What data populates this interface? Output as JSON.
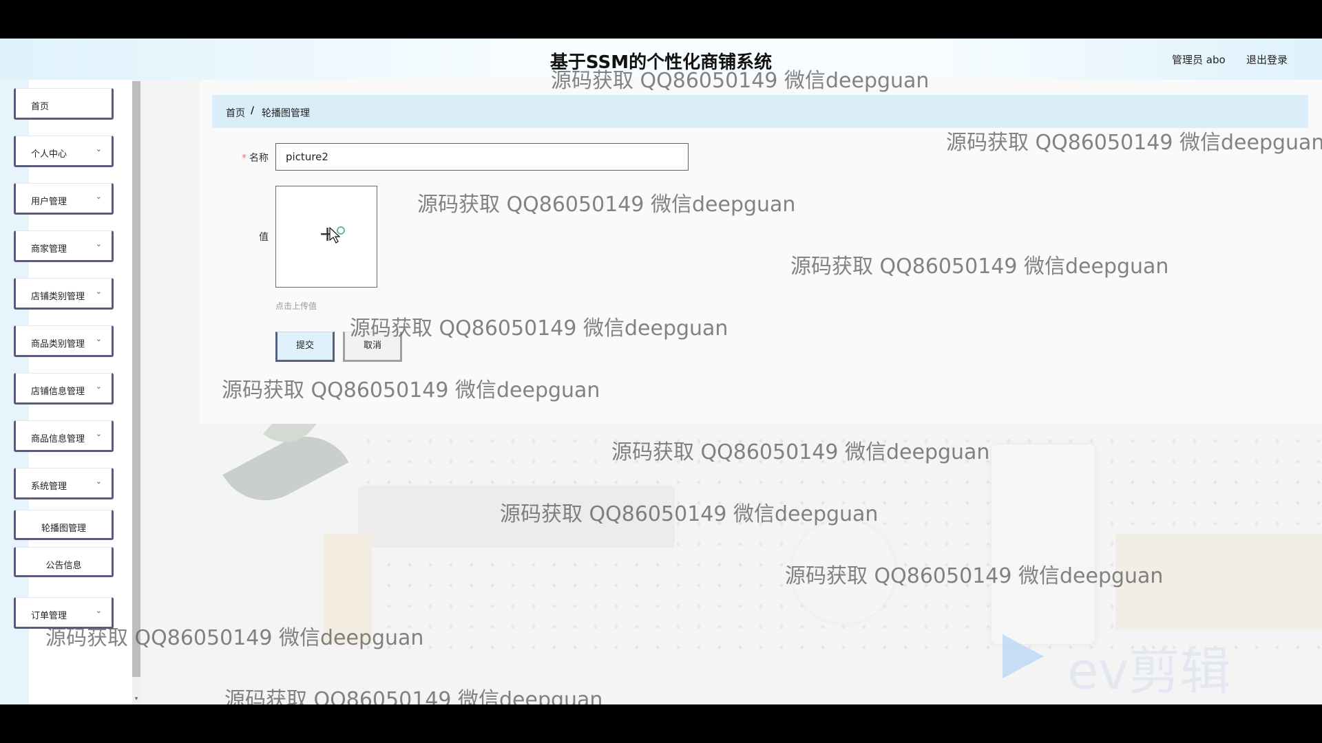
{
  "header": {
    "title": "基于SSM的个性化商铺系统",
    "user": "管理员 abo",
    "logout": "退出登录"
  },
  "sidebar": {
    "items": [
      {
        "label": "首页"
      },
      {
        "label": "个人中心"
      },
      {
        "label": "用户管理"
      },
      {
        "label": "商家管理"
      },
      {
        "label": "店铺类别管理"
      },
      {
        "label": "商品类别管理"
      },
      {
        "label": "店铺信息管理"
      },
      {
        "label": "商品信息管理"
      },
      {
        "label": "系统管理"
      },
      {
        "label": "轮播图管理"
      },
      {
        "label": "公告信息"
      },
      {
        "label": "订单管理"
      }
    ]
  },
  "breadcrumb": {
    "home": "首页",
    "separator": "/",
    "current": "轮播图管理"
  },
  "form": {
    "name_label": "名称",
    "required_mark": "*",
    "name_value": "picture2",
    "value_label": "值",
    "upload_tip": "点击上传值",
    "submit": "提交",
    "cancel": "取消"
  },
  "watermark": "源码获取 QQ86050149 微信deepguan",
  "ev_logo": "ev剪辑",
  "icons": {
    "chevron": "chevron-down-icon",
    "upload": "plus-icon"
  }
}
